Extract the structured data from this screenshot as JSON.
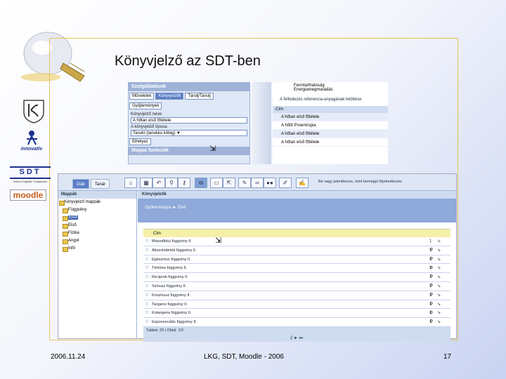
{
  "slide": {
    "title": "Könyvjelző az SDT-ben",
    "footer_date": "2006.11.24",
    "footer_center": "LKG, SDT, Moodle - 2006",
    "page_number": "17",
    "accent": "#5b7ec7"
  },
  "logos": {
    "innovativ": "innovatív",
    "sdt": "SDT",
    "sdt_sub": "Sulinet Digitális Tudásbázis",
    "moodle": "moodle"
  },
  "top_left_panel": {
    "header": "Szolgáltatások",
    "buttons": [
      "Műveletek",
      "Könyvjelzők",
      "Tárolj/Tanulj"
    ],
    "button2": "Gyűjtemények",
    "name_label": "Könyvjelző neve:",
    "name_value": "A hőtan első főtétele",
    "type_label": "A könyvjelző típusa:",
    "type_value": "Tanuló (tanulási köteg) ▼",
    "ok_button": "Elhelyez",
    "footer": "Mappa funkciók"
  },
  "top_right_panel": {
    "items": [
      "Fenntarthatóság",
      "Energiamegmaradás"
    ],
    "link": "A felfedezés referencia-anyagának letöltése",
    "col_header": "Cím",
    "rows": [
      "A hőtan első főtétele",
      "A hőtő Proentropia",
      "A hőtan első főtétele",
      "A hőtan első főtétele"
    ]
  },
  "app": {
    "tabs": [
      "Diák",
      "Tanár"
    ],
    "toolbar_text": "Be vagy jelentkezve, mint bemegyt  Kijelentkezés",
    "sidebar_header": "Mappák",
    "tree_root": "Könyvjelző mappák",
    "tree": [
      "Függvény",
      "Első",
      "Első",
      "Fizika",
      "Angol",
      "Infó"
    ],
    "tree_selected_index": 1,
    "main_header": "Könyvjelzők",
    "breadcrumb": "Gyökérmappa ► Első",
    "col_title": "Cím",
    "rows": [
      "Másodfokú függvény II.",
      "Abszolútérték függvény II.",
      "Egészrész függvény II.",
      "Törtrész függvény II.",
      "Reciprok függvény II.",
      "Szinusz függvény II.",
      "Koszinusz függvény II.",
      "Tangens függvény II.",
      "Kotangens függvény II.",
      "Exponenciális függvény II."
    ],
    "row_actions": "1 ⇘ ⚙",
    "pager_text": "Találat: 20 | Oldal: 1/2",
    "pager_nav": "2 ► ⏭"
  }
}
